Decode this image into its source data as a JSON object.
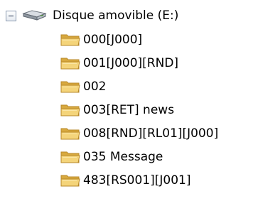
{
  "tree": {
    "root": {
      "label": "Disque amovible (E:)",
      "expander": "collapse-minus-icon",
      "icon": "removable-drive-icon"
    },
    "folders": [
      {
        "label": "000[J000]",
        "icon": "folder-icon"
      },
      {
        "label": "001[J000][RND]",
        "icon": "folder-icon"
      },
      {
        "label": "002",
        "icon": "folder-icon"
      },
      {
        "label": "003[RET] news",
        "icon": "folder-icon"
      },
      {
        "label": "008[RND][RL01][J000]",
        "icon": "folder-icon"
      },
      {
        "label": "035 Message",
        "icon": "folder-icon"
      },
      {
        "label": "483[RS001][J001]",
        "icon": "folder-icon"
      }
    ]
  },
  "colors": {
    "folder_fill": "#f4d47a",
    "folder_shade": "#d8a93e",
    "folder_outline": "#b8892a",
    "expander_border": "#8c9bb0"
  }
}
